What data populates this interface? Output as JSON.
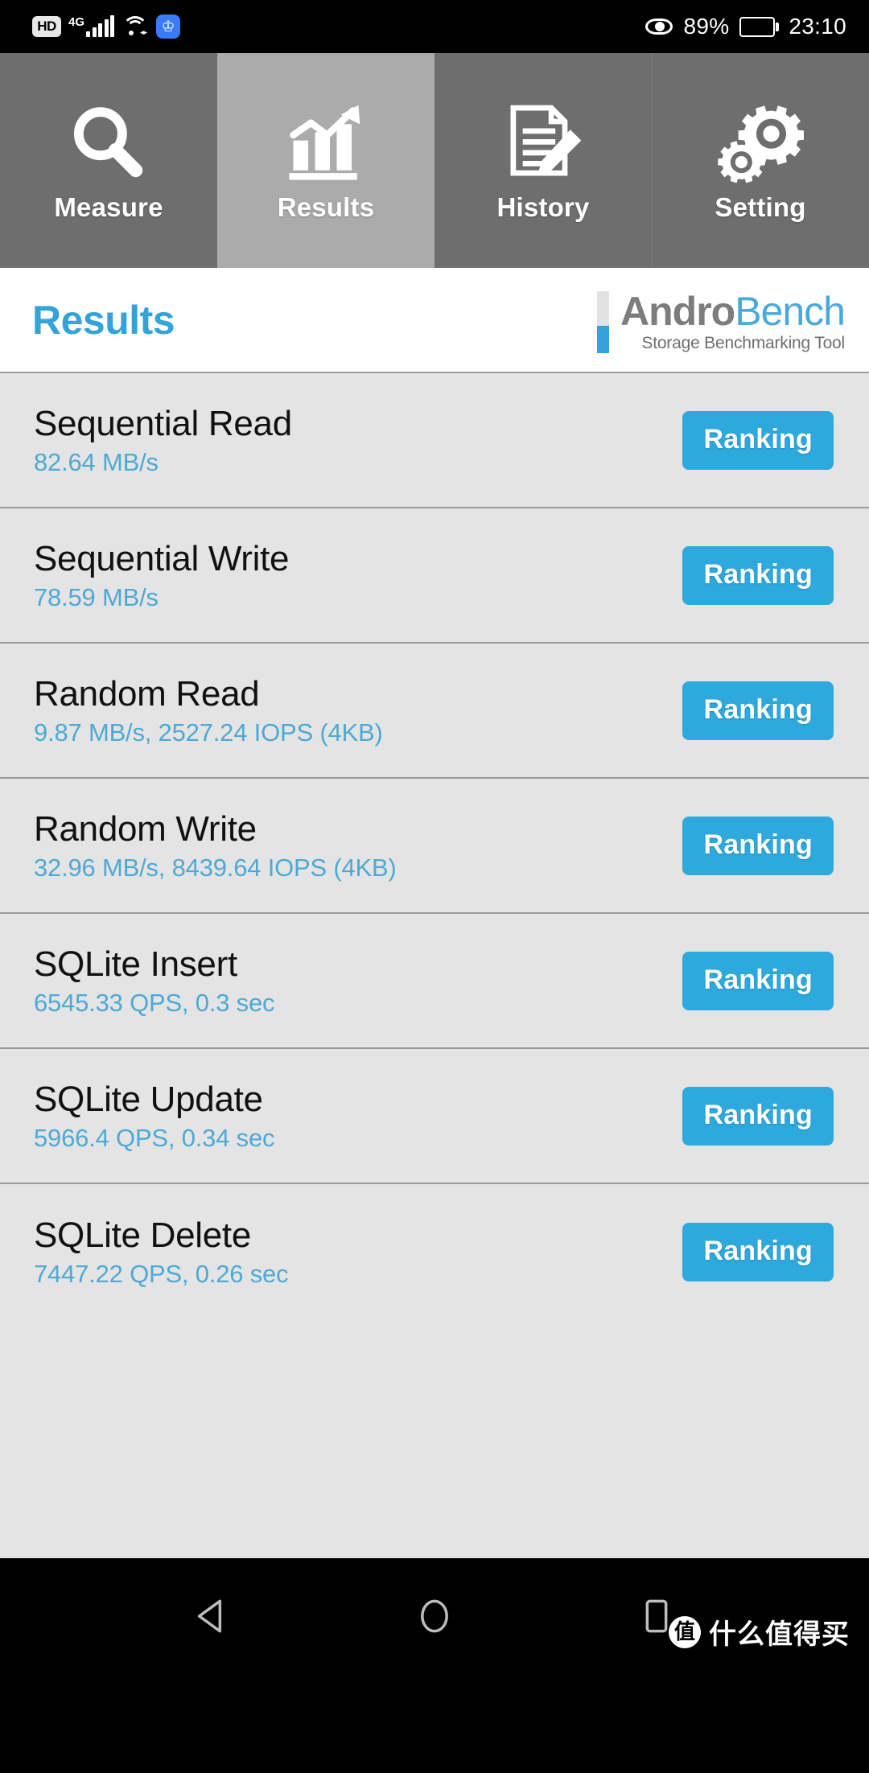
{
  "status_bar": {
    "hd_label": "HD",
    "network_label": "4G",
    "signal_icon": "signal-bars-icon",
    "wifi_icon": "wifi-icon",
    "app_icon": "blue-app-icon",
    "eye_icon": "eye-icon",
    "battery_percent": "89%",
    "battery_icon": "battery-icon",
    "clock": "23:10"
  },
  "tabs": [
    {
      "label": "Measure",
      "icon": "magnifier-icon",
      "active": false
    },
    {
      "label": "Results",
      "icon": "bar-chart-arrow-icon",
      "active": true
    },
    {
      "label": "History",
      "icon": "document-pencil-icon",
      "active": false
    },
    {
      "label": "Setting",
      "icon": "gears-icon",
      "active": false
    }
  ],
  "header": {
    "page_title": "Results",
    "brand_first": "Andro",
    "brand_second": "Bench",
    "brand_tagline": "Storage Benchmarking Tool"
  },
  "results": [
    {
      "title": "Sequential Read",
      "value": "82.64 MB/s",
      "button": "Ranking"
    },
    {
      "title": "Sequential Write",
      "value": "78.59 MB/s",
      "button": "Ranking"
    },
    {
      "title": "Random Read",
      "value": "9.87 MB/s, 2527.24 IOPS (4KB)",
      "button": "Ranking"
    },
    {
      "title": "Random Write",
      "value": "32.96 MB/s, 8439.64 IOPS (4KB)",
      "button": "Ranking"
    },
    {
      "title": "SQLite Insert",
      "value": "6545.33 QPS, 0.3 sec",
      "button": "Ranking"
    },
    {
      "title": "SQLite Update",
      "value": "5966.4 QPS, 0.34 sec",
      "button": "Ranking"
    },
    {
      "title": "SQLite Delete",
      "value": "7447.22 QPS, 0.26 sec",
      "button": "Ranking"
    }
  ],
  "nav_bar": {
    "back_icon": "back-triangle-icon",
    "home_icon": "home-circle-icon",
    "recents_icon": "recents-square-icon"
  },
  "watermark": {
    "logo_char": "值",
    "text": "什么值得买"
  },
  "colors": {
    "accent_blue": "#2ea9de",
    "title_blue": "#34a3d9",
    "value_blue": "#4ea9d6",
    "tab_inactive": "#6e6e6e",
    "tab_active": "#ababab",
    "list_bg": "#e4e4e4",
    "brand_gray": "#7d7d7d"
  }
}
